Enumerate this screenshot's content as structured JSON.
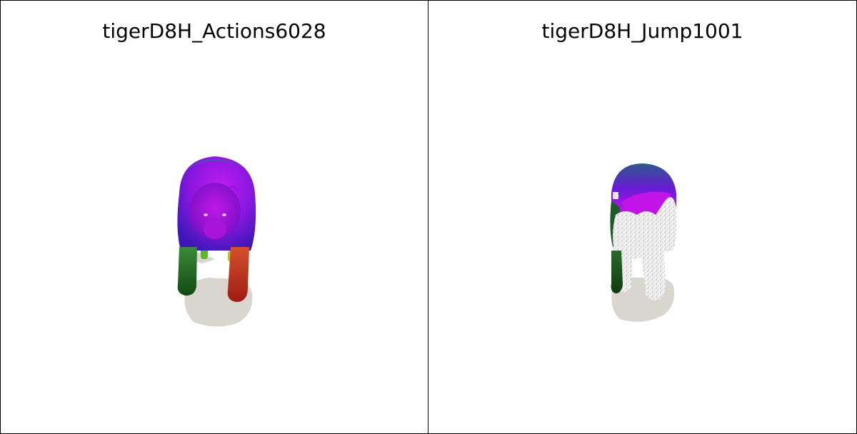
{
  "panels": [
    {
      "title": "tigerD8H_Actions6028"
    },
    {
      "title": "tigerD8H_Jump1001"
    }
  ],
  "colors": {
    "border": "#000000",
    "background": "#ffffff",
    "shadow": "#d9d6cf",
    "mesh_purple": "#b010e8",
    "mesh_blue": "#4a1ad0",
    "mesh_green": "#1f8a1f",
    "mesh_red": "#e0402a",
    "noise_white": "#eeeeee"
  }
}
